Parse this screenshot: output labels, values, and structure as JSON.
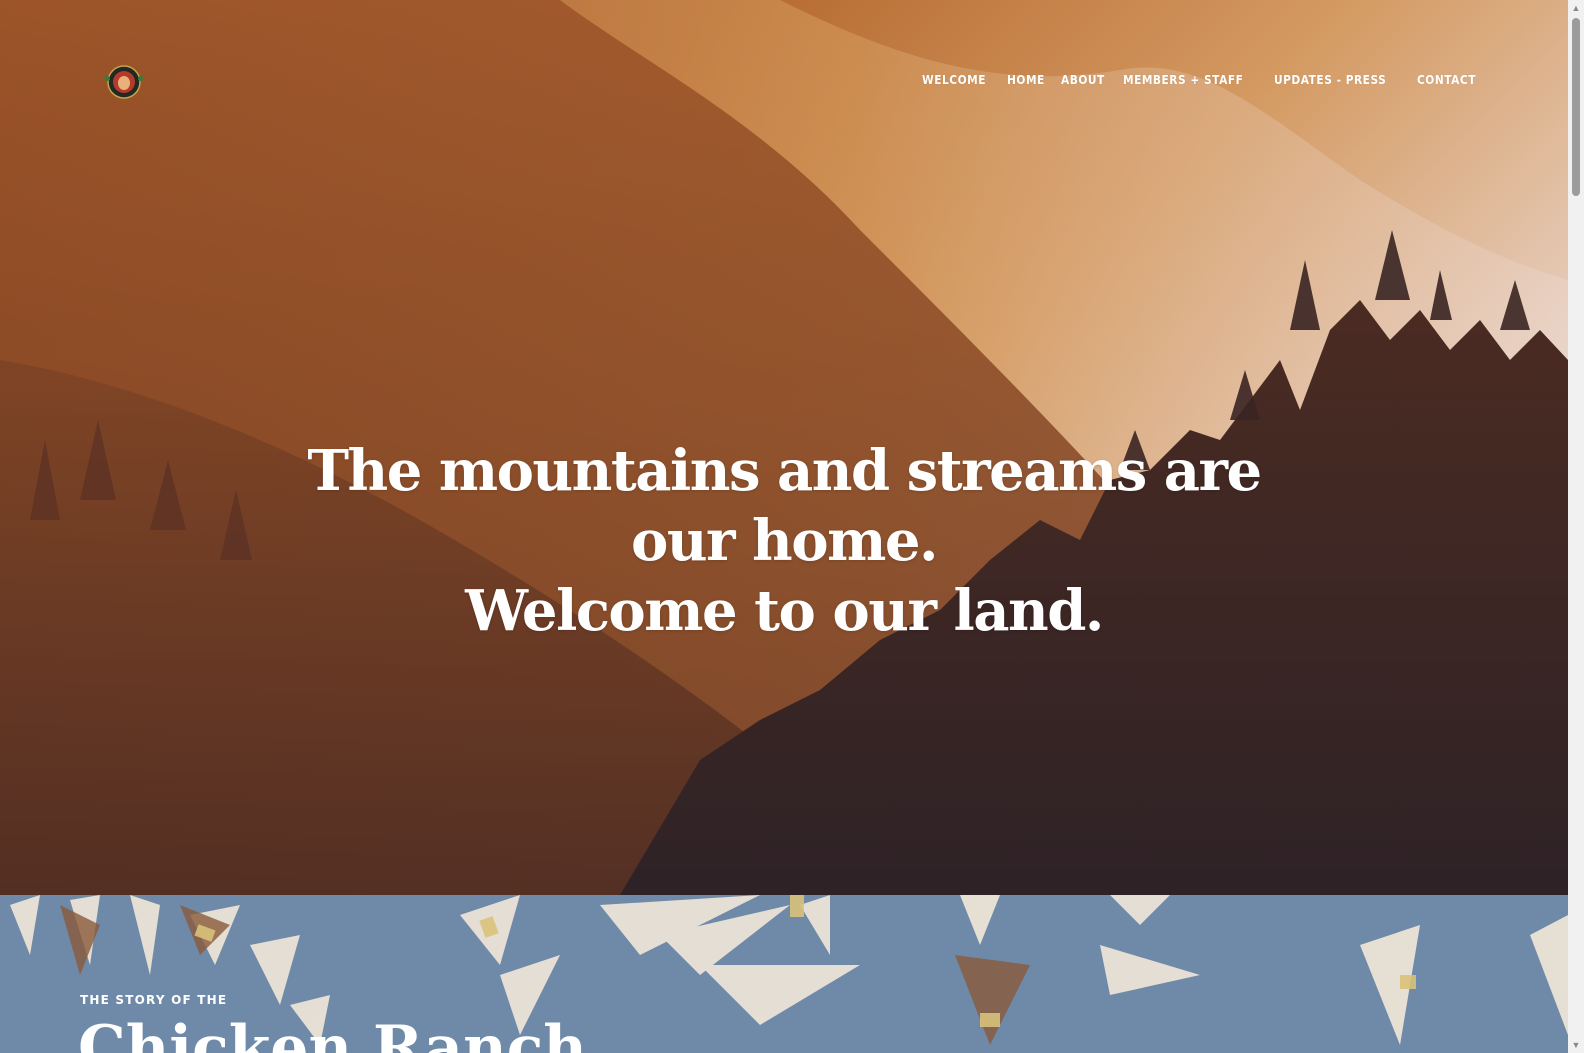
{
  "nav": {
    "items": [
      {
        "label": "WELCOME"
      },
      {
        "label": "HOME"
      },
      {
        "label": "ABOUT"
      },
      {
        "label": "MEMBERS + STAFF"
      },
      {
        "label": "UPDATES - PRESS"
      },
      {
        "label": "CONTACT"
      }
    ]
  },
  "hero": {
    "headline_line1": "The mountains and streams are",
    "headline_line2": "our home.",
    "headline_line3": "Welcome to our land."
  },
  "story": {
    "eyebrow": "THE STORY OF THE",
    "title": "Chicken Ranch"
  },
  "icons": {
    "logo": "tribal-seal-logo",
    "scroll_up": "scroll-up-arrow-icon",
    "scroll_down": "scroll-down-arrow-icon"
  },
  "colors": {
    "nav_text": "#ffffff",
    "headline_text": "#ffffff",
    "story_background": "#6f8aa8"
  }
}
